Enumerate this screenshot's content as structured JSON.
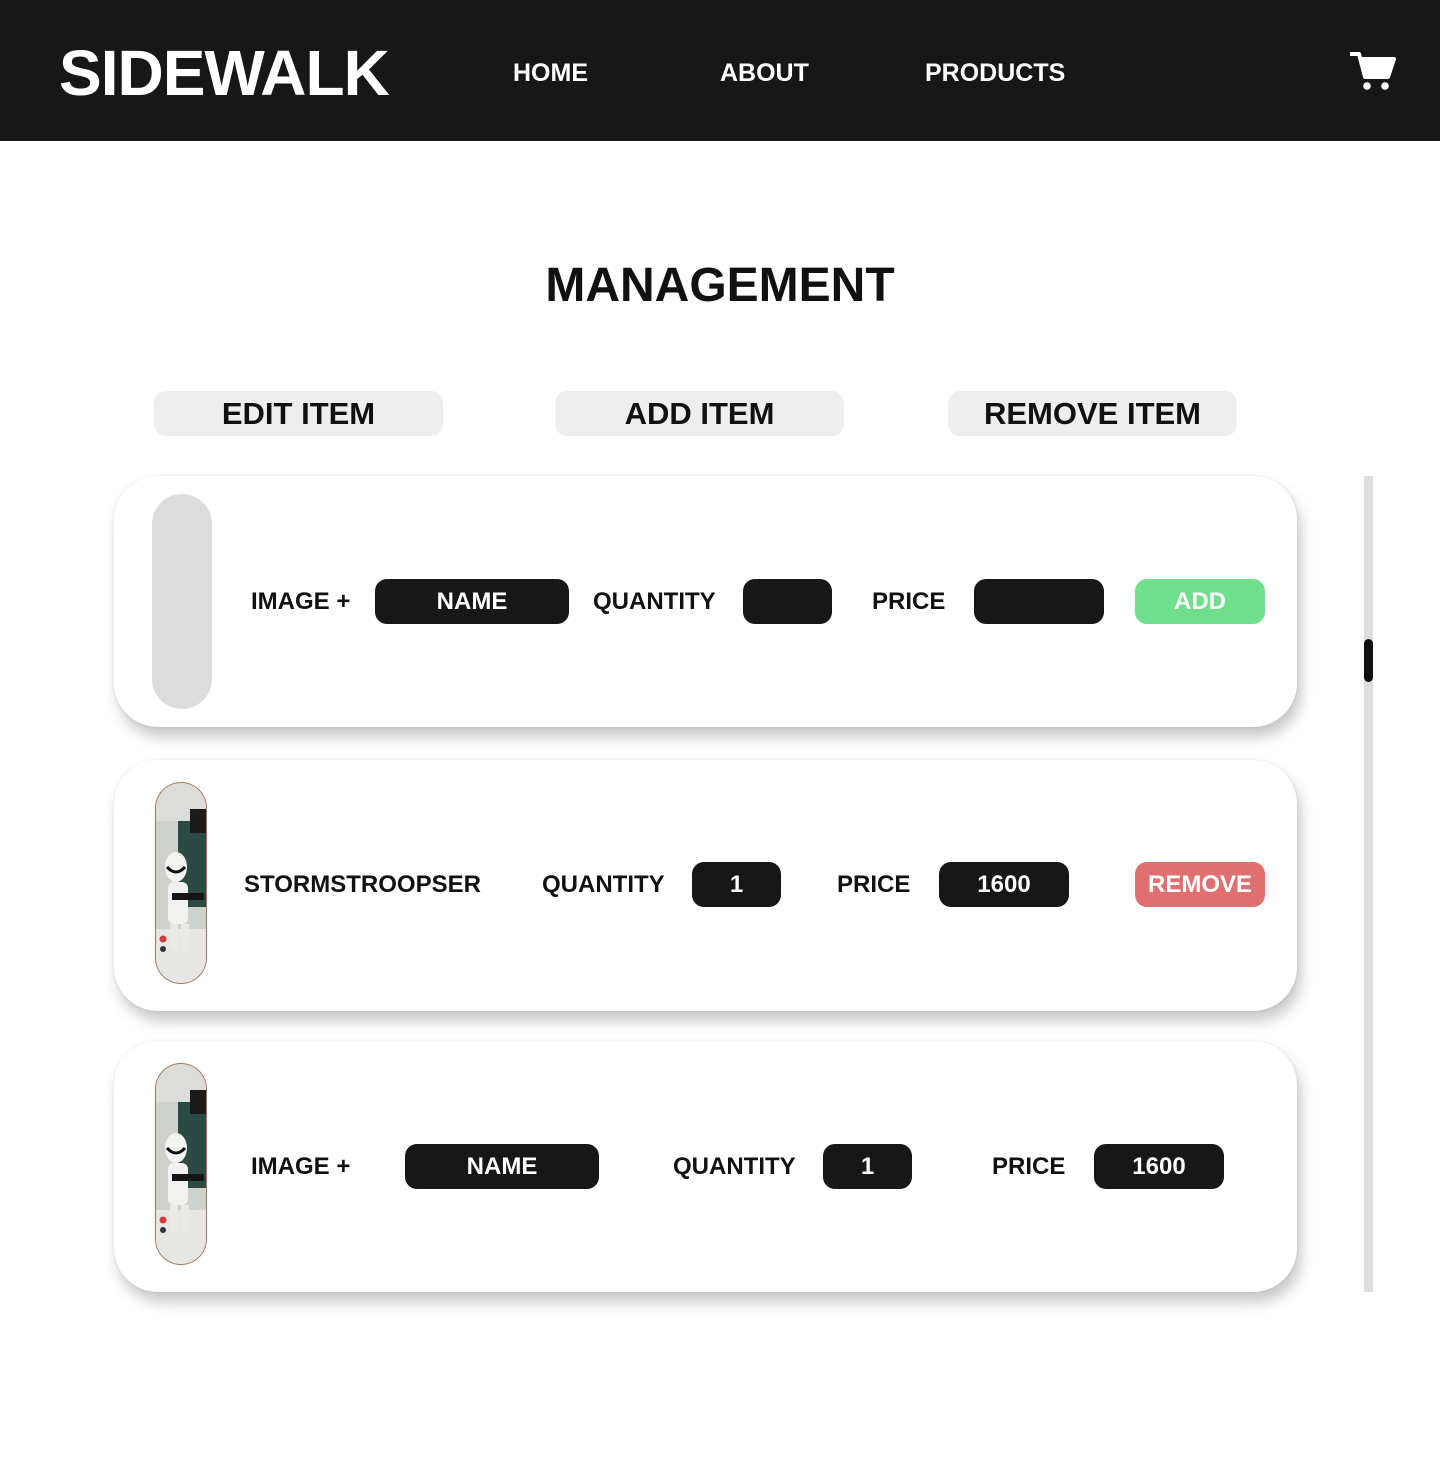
{
  "header": {
    "logo": "SIDEWALK",
    "nav": [
      {
        "label": "HOME"
      },
      {
        "label": "ABOUT"
      },
      {
        "label": "PRODUCTS"
      }
    ],
    "cart_icon": "shopping-cart-icon"
  },
  "main": {
    "title": "MANAGEMENT",
    "tabs": [
      {
        "label": "EDIT ITEM"
      },
      {
        "label": "ADD ITEM"
      },
      {
        "label": "REMOVE ITEM"
      }
    ]
  },
  "add_row": {
    "image_label": "IMAGE +",
    "name_placeholder": "NAME",
    "quantity_label": "QUANTITY",
    "quantity_value": "",
    "price_label": "PRICE",
    "price_value": "",
    "add_button": "ADD"
  },
  "items": [
    {
      "name": "STORMSTROOPSER",
      "quantity_label": "QUANTITY",
      "quantity": "1",
      "price_label": "PRICE",
      "price": "1600",
      "remove_button": "REMOVE"
    }
  ],
  "edit_row": {
    "image_label": "IMAGE +",
    "name_placeholder": "NAME",
    "quantity_label": "QUANTITY",
    "quantity": "1",
    "price_label": "PRICE",
    "price": "1600"
  },
  "colors": {
    "navbar": "#171717",
    "pill": "#171717",
    "add_button": "#6fdf8b",
    "remove_button": "#e07070",
    "tab_background": "#eeeeee",
    "scroll_track": "#dedede"
  }
}
